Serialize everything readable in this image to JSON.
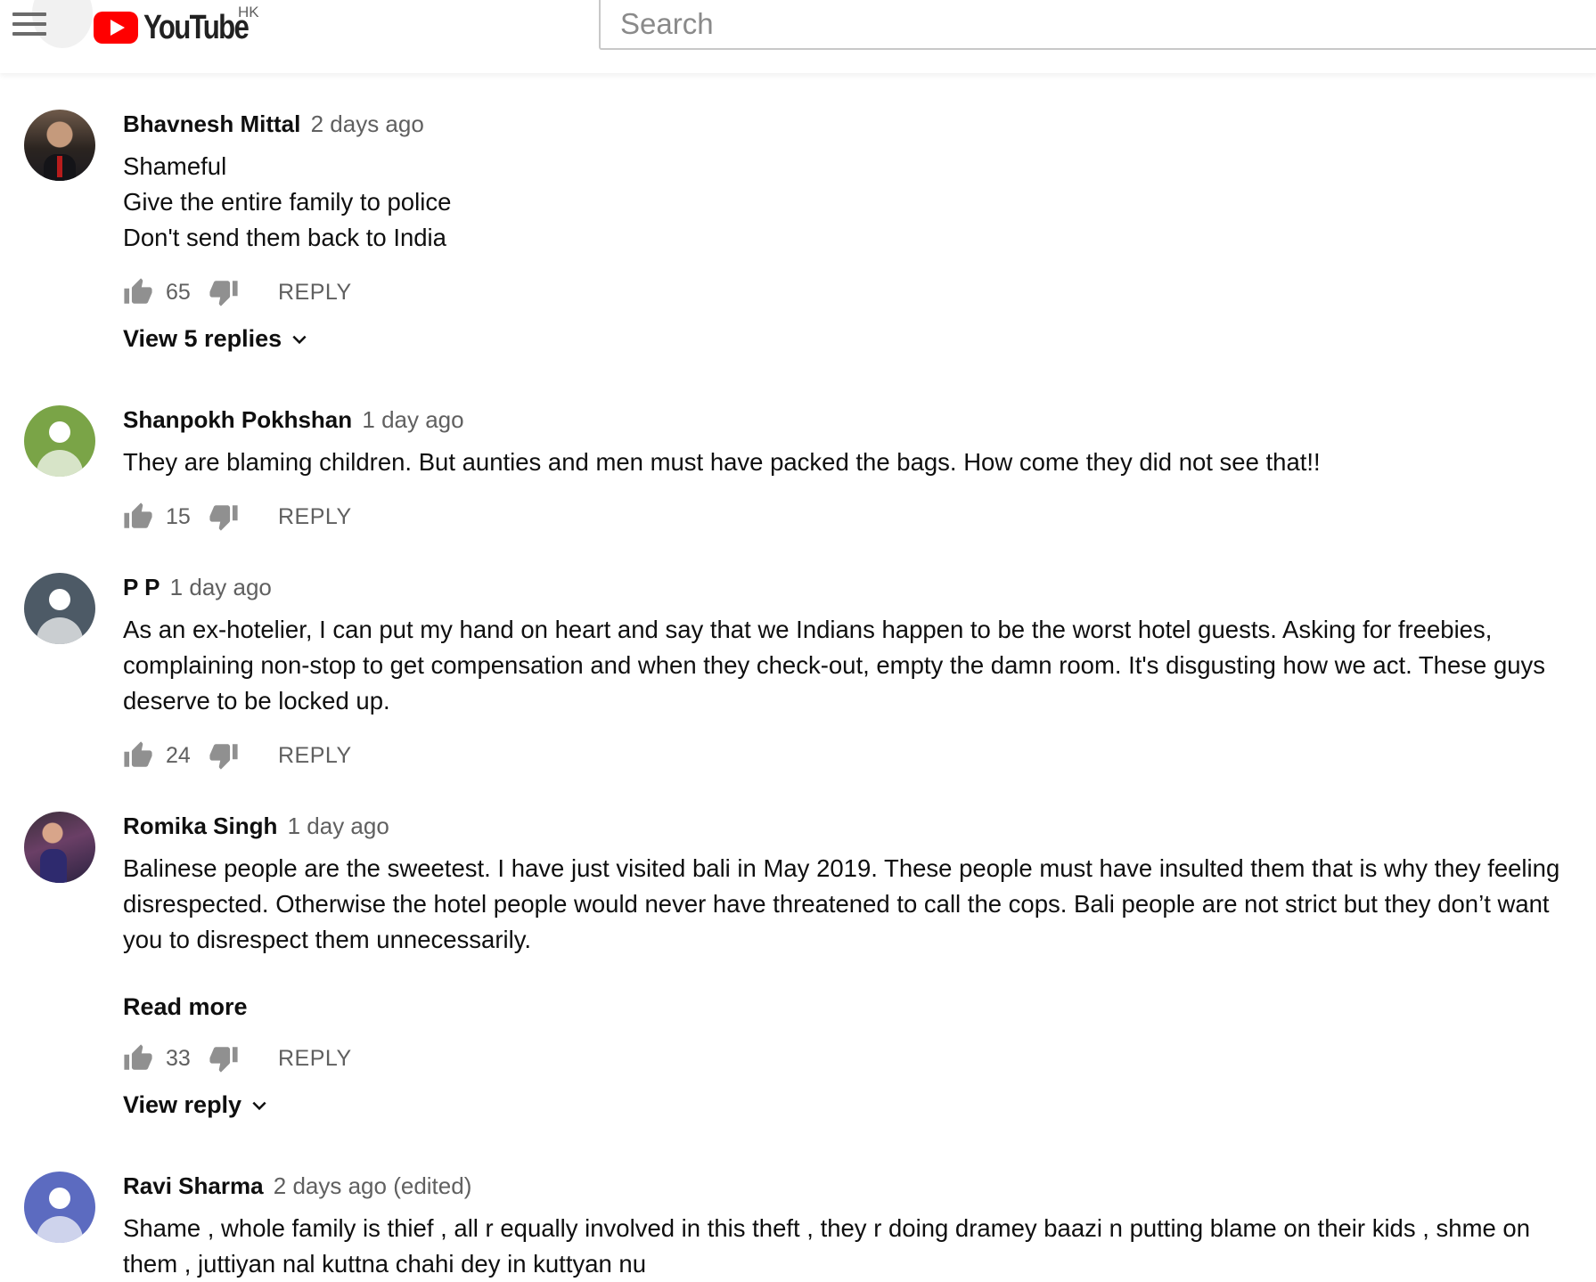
{
  "header": {
    "logo_text": "YouTube",
    "region": "HK",
    "search_placeholder": "Search"
  },
  "colors": {
    "brand_red": "#ff0000",
    "secondary_text": "#606060",
    "avatar_green": "#7aa447",
    "avatar_slate": "#4d5a66",
    "avatar_indigo": "#5c6bc0"
  },
  "comments": [
    {
      "author": "Bhavnesh Mittal",
      "time": "2 days ago",
      "text": "Shameful\nGive the entire family to police\nDon't send them back to India",
      "likes": "65",
      "reply_label": "REPLY",
      "replies_label": "View 5 replies"
    },
    {
      "author": "Shanpokh Pokhshan",
      "time": "1 day ago",
      "text": "They are blaming children. But aunties and men must have packed the bags. How come they did not see that!!",
      "likes": "15",
      "reply_label": "REPLY"
    },
    {
      "author": "P P",
      "time": "1 day ago",
      "text": "As an ex-hotelier, I can put my hand on heart and say that we Indians happen to be the worst hotel guests. Asking for freebies, complaining non-stop to get compensation and when they check-out, empty the damn room. It's disgusting how we act. These guys deserve to be locked up.",
      "likes": "24",
      "reply_label": "REPLY"
    },
    {
      "author": "Romika Singh",
      "time": "1 day ago",
      "text": "Balinese people are the sweetest. I have just visited bali in May 2019. These people must have insulted them that is why they feeling disrespected. Otherwise the hotel people would never have threatened to call the cops. Bali people are not strict but they don’t want you to disrespect them unnecessarily.",
      "read_more": "Read more",
      "likes": "33",
      "reply_label": "REPLY",
      "replies_label": "View reply"
    },
    {
      "author": "Ravi Sharma",
      "time": "2 days ago (edited)",
      "text": "Shame , whole family is thief , all r equally involved in this theft , they r doing dramey baazi n putting blame on their kids , shme on them , juttiyan nal kuttna chahi dey in kuttyan nu"
    }
  ]
}
